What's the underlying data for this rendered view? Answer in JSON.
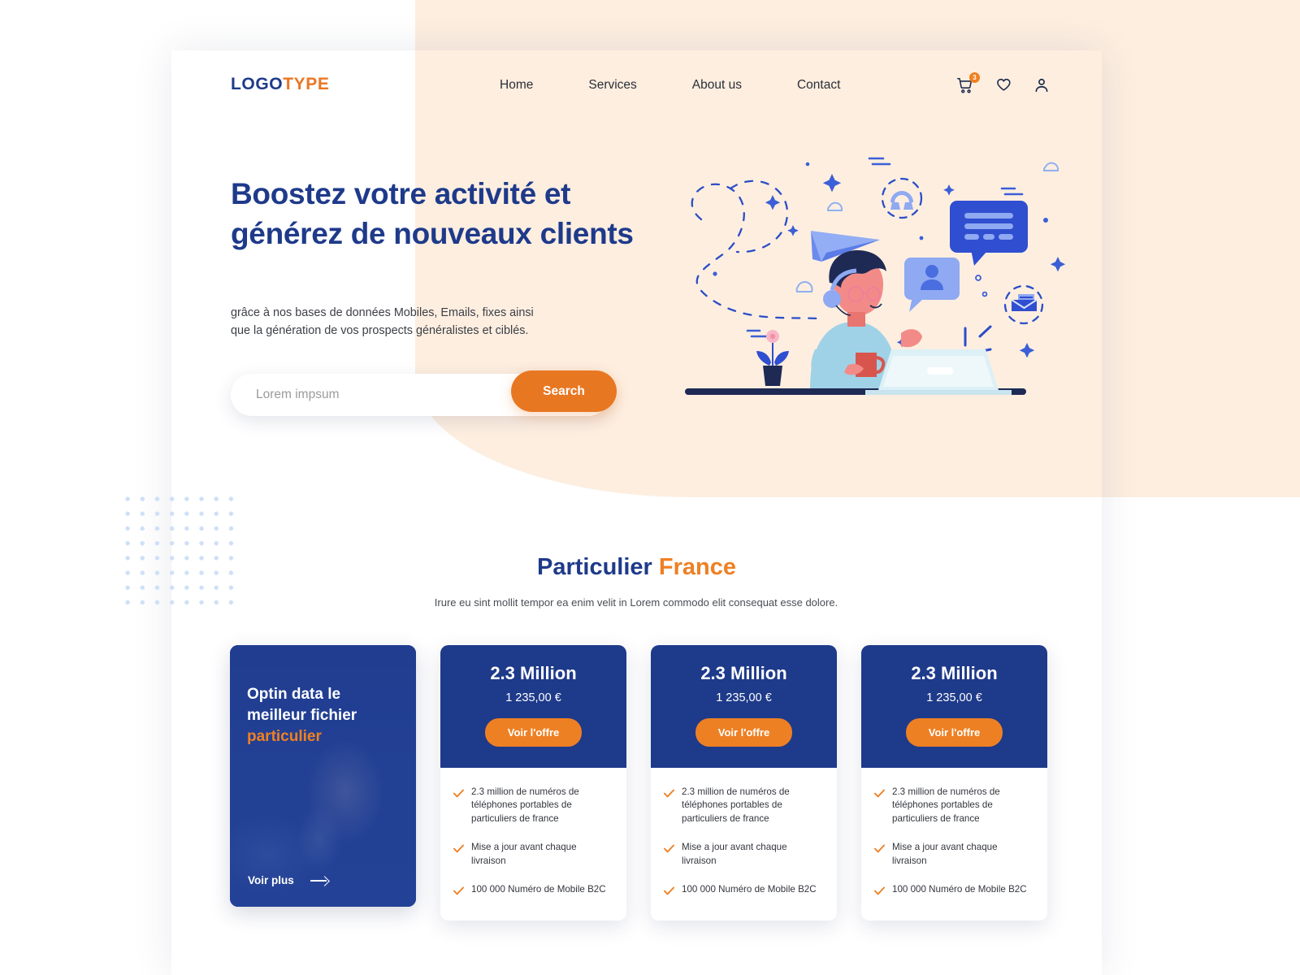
{
  "colors": {
    "brand_blue": "#1e3a8a",
    "brand_orange": "#ee8024",
    "hero_peach": "#fdeee0",
    "dot_blue": "#cfe0f7",
    "page_white": "#ffffff"
  },
  "header": {
    "logo": {
      "part1": "LOGO",
      "part2": "TYPE"
    },
    "nav": [
      {
        "label": "Home"
      },
      {
        "label": "Services"
      },
      {
        "label": "About us"
      },
      {
        "label": "Contact"
      }
    ],
    "icons": [
      {
        "name": "cart-icon",
        "badge": "3"
      },
      {
        "name": "heart-icon"
      },
      {
        "name": "user-icon"
      }
    ]
  },
  "hero": {
    "title_line1": "Boostez votre activité et",
    "title_line2": "générez de nouveaux clients",
    "subtitle_line1": "grâce à nos bases de données Mobiles, Emails, fixes ainsi",
    "subtitle_line2": "que la génération de vos prospects généralistes et ciblés.",
    "search": {
      "placeholder": "Lorem impsum",
      "value": "",
      "button_label": "Search"
    },
    "illustration": "customer-support-agent-illustration"
  },
  "section": {
    "title_blue": "Particulier",
    "title_orange": "France",
    "subtitle_line1": "Irure eu sint mollit tempor ea enim velit in Lorem commodo elit",
    "subtitle_line2": "consequat esse dolore."
  },
  "promo_card": {
    "title_line1": "Optin data le",
    "title_line2": "meilleur fichier",
    "title_highlight": "particulier",
    "link_label": "Voir plus"
  },
  "pricing_cards": [
    {
      "amount": "2.3 Million",
      "price": "1 235,00 €",
      "button_label": "Voir l'offre",
      "features": [
        "2.3 million de numéros de téléphones portables de particuliers de france",
        "Mise a jour avant chaque livraison",
        "100 000 Numéro de Mobile B2C"
      ]
    },
    {
      "amount": "2.3 Million",
      "price": "1 235,00 €",
      "button_label": "Voir l'offre",
      "features": [
        "2.3 million de numéros de téléphones portables de particuliers de france",
        "Mise a jour avant chaque livraison",
        "100 000 Numéro de Mobile B2C"
      ]
    },
    {
      "amount": "2.3 Million",
      "price": "1 235,00 €",
      "button_label": "Voir l'offre",
      "features": [
        "2.3 million de numéros de téléphones portables de particuliers de france",
        "Mise a jour avant chaque livraison",
        "100 000 Numéro de Mobile B2C"
      ]
    }
  ]
}
